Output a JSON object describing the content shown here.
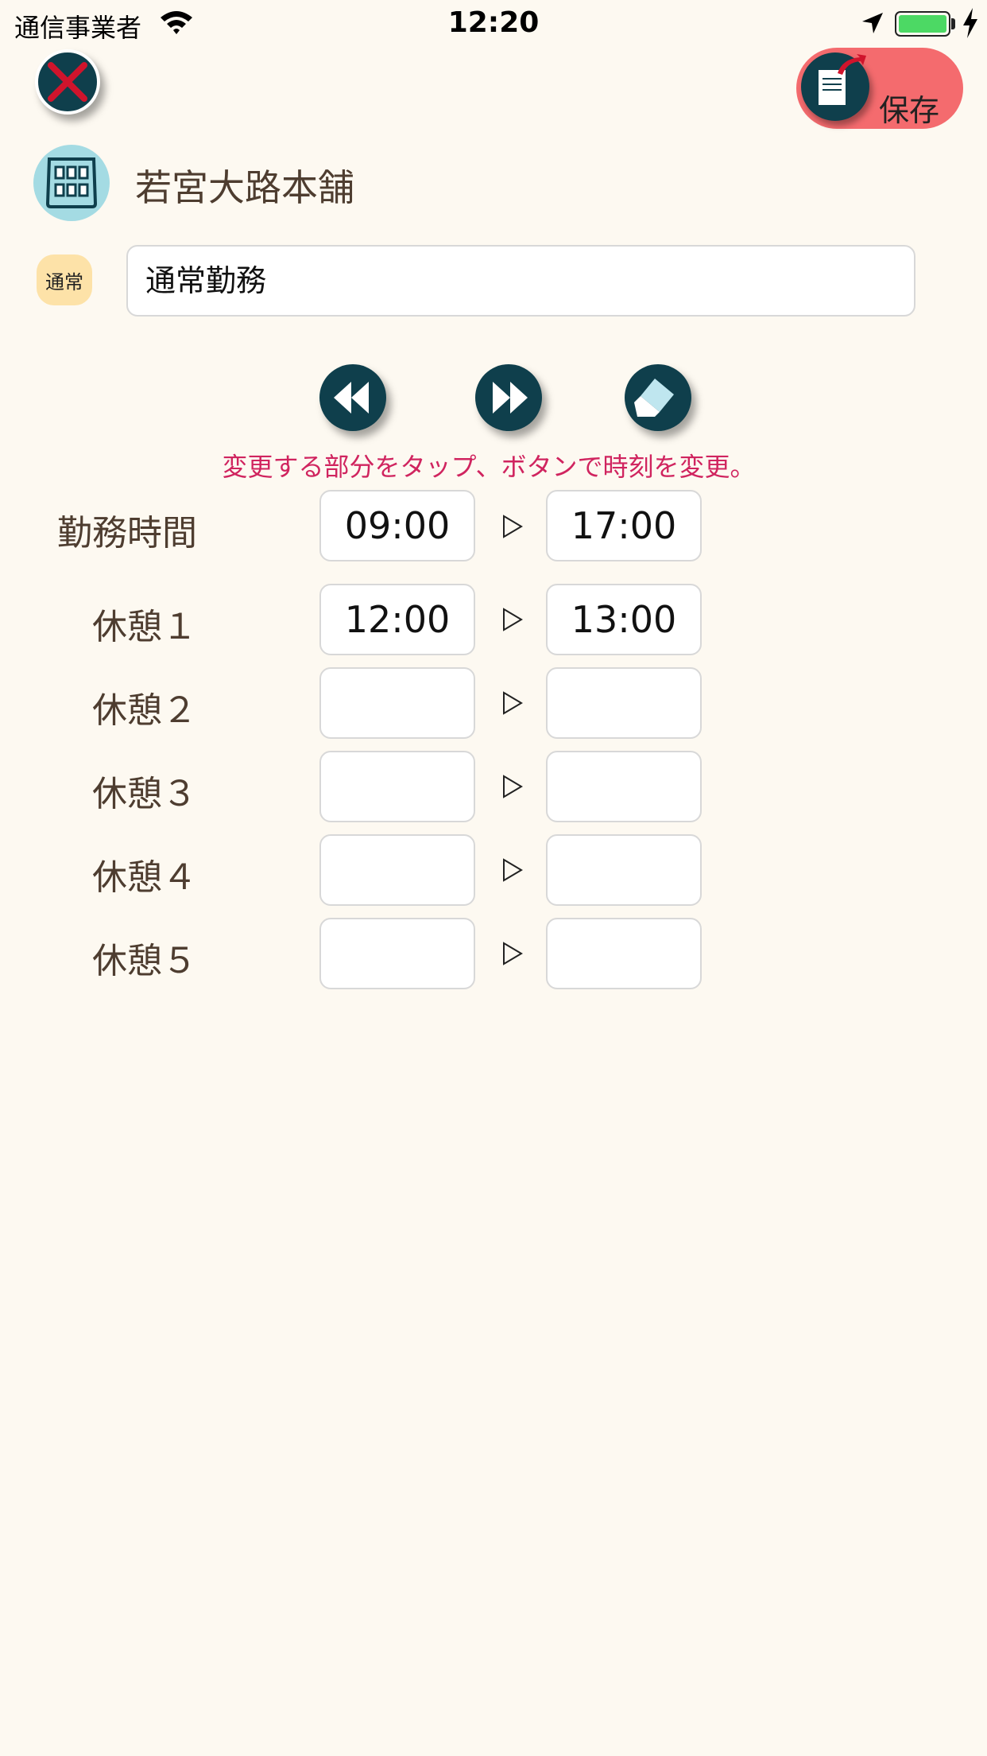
{
  "status_bar": {
    "carrier": "通信事業者",
    "time": "12:20"
  },
  "header": {
    "save_label": "保存"
  },
  "store": {
    "name": "若宮大路本舗"
  },
  "shift": {
    "badge": "通常",
    "name": "通常勤務"
  },
  "hint": "変更する部分をタップ、ボタンで時刻を変更。",
  "rows": [
    {
      "label": "勤務時間",
      "start": "09:00",
      "end": "17:00"
    },
    {
      "label": "休憩１",
      "start": "12:00",
      "end": "13:00"
    },
    {
      "label": "休憩２",
      "start": "",
      "end": ""
    },
    {
      "label": "休憩３",
      "start": "",
      "end": ""
    },
    {
      "label": "休憩４",
      "start": "",
      "end": ""
    },
    {
      "label": "休憩５",
      "start": "",
      "end": ""
    }
  ],
  "colors": {
    "background": "#fdf9f1",
    "accent_dark": "#0f3f4c",
    "save": "#f46b6e",
    "hint": "#d0245f"
  }
}
